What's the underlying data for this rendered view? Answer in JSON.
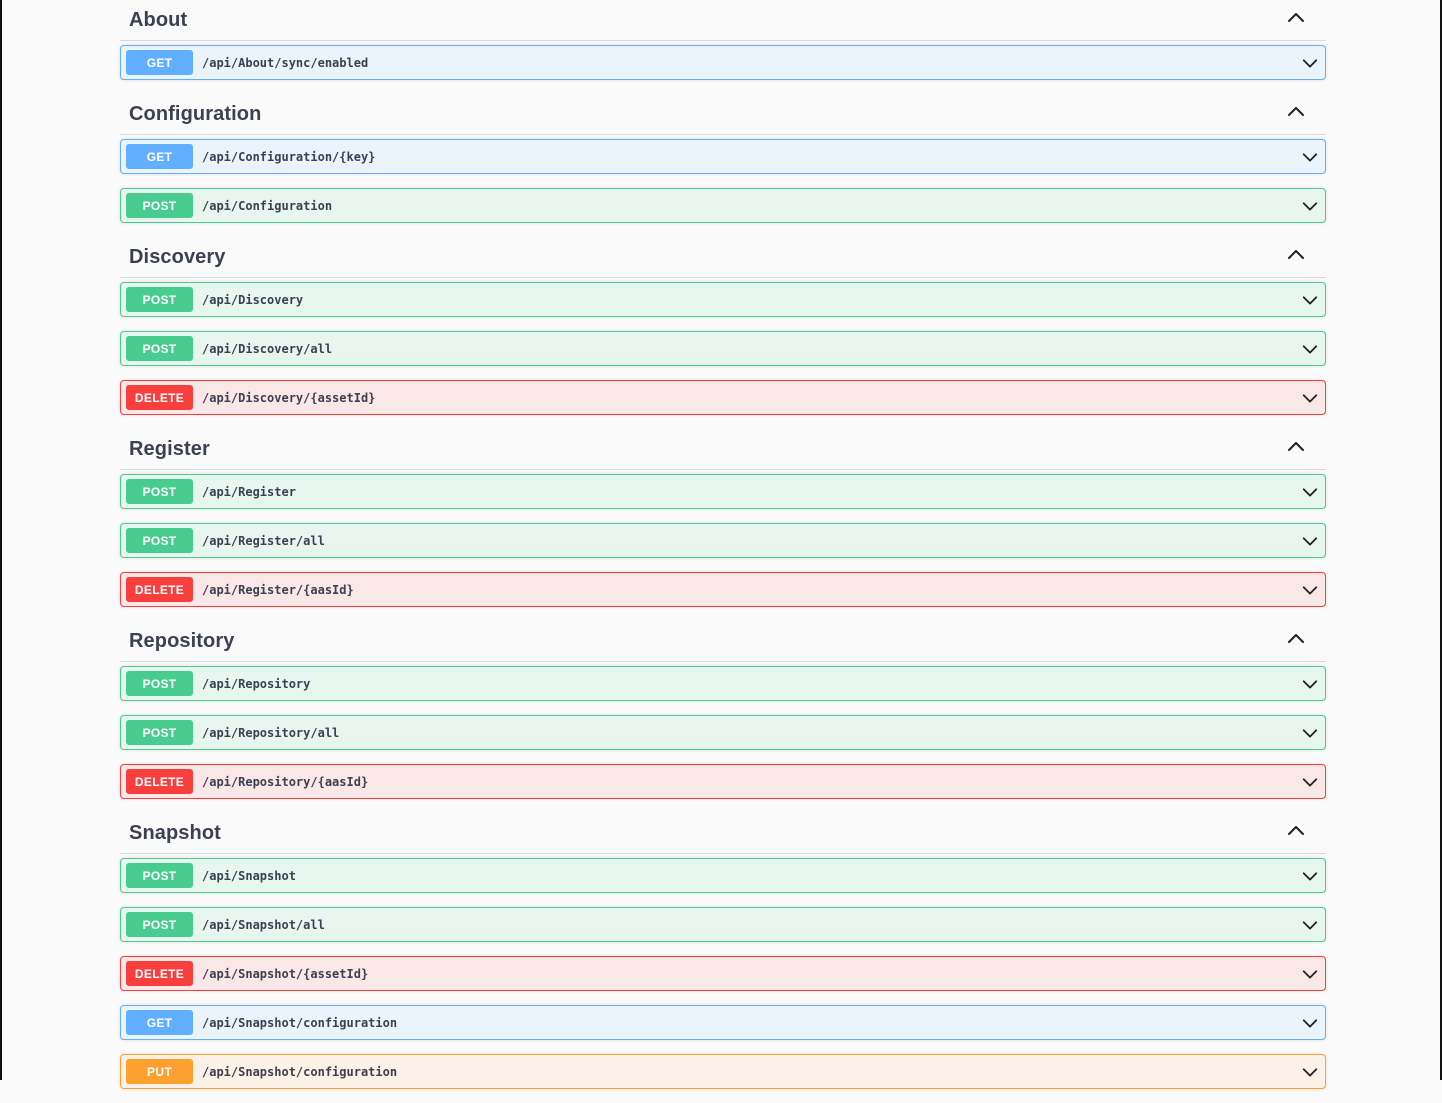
{
  "colors": {
    "get": "#61affe",
    "post": "#49cc90",
    "delete": "#f93e3e",
    "put": "#fca130",
    "text": "#3b4151"
  },
  "icons": {
    "collapse": "chevron-up-icon",
    "expand": "chevron-down-icon"
  },
  "sections": [
    {
      "title": "About",
      "operations": [
        {
          "method": "GET",
          "path": "/api/About/sync/enabled"
        }
      ]
    },
    {
      "title": "Configuration",
      "operations": [
        {
          "method": "GET",
          "path": "/api/Configuration/{key}"
        },
        {
          "method": "POST",
          "path": "/api/Configuration"
        }
      ]
    },
    {
      "title": "Discovery",
      "operations": [
        {
          "method": "POST",
          "path": "/api/Discovery"
        },
        {
          "method": "POST",
          "path": "/api/Discovery/all"
        },
        {
          "method": "DELETE",
          "path": "/api/Discovery/{assetId}"
        }
      ]
    },
    {
      "title": "Register",
      "operations": [
        {
          "method": "POST",
          "path": "/api/Register"
        },
        {
          "method": "POST",
          "path": "/api/Register/all"
        },
        {
          "method": "DELETE",
          "path": "/api/Register/{aasId}"
        }
      ]
    },
    {
      "title": "Repository",
      "operations": [
        {
          "method": "POST",
          "path": "/api/Repository"
        },
        {
          "method": "POST",
          "path": "/api/Repository/all"
        },
        {
          "method": "DELETE",
          "path": "/api/Repository/{aasId}"
        }
      ]
    },
    {
      "title": "Snapshot",
      "operations": [
        {
          "method": "POST",
          "path": "/api/Snapshot"
        },
        {
          "method": "POST",
          "path": "/api/Snapshot/all"
        },
        {
          "method": "DELETE",
          "path": "/api/Snapshot/{assetId}"
        },
        {
          "method": "GET",
          "path": "/api/Snapshot/configuration"
        },
        {
          "method": "PUT",
          "path": "/api/Snapshot/configuration"
        }
      ]
    }
  ]
}
